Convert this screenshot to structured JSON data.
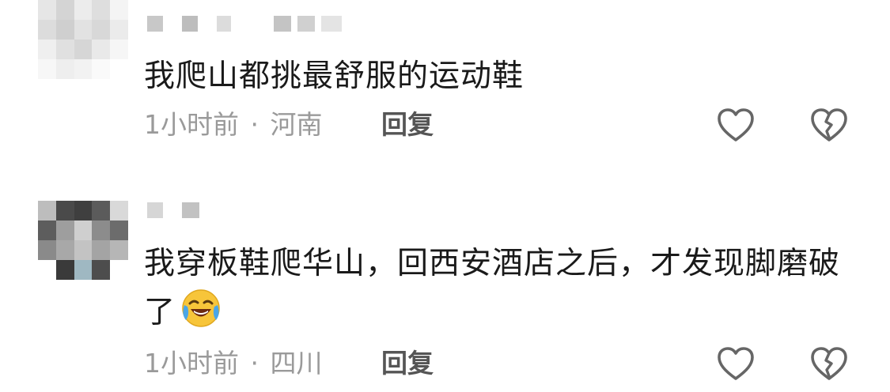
{
  "comments": [
    {
      "text": "我爬山都挑最舒服的运动鞋",
      "time": "1小时前",
      "separator": "·",
      "location": "河南",
      "reply_label": "回复"
    },
    {
      "text": "我穿板鞋爬华山，回西安酒店之后，才发现脚磨破了",
      "emoji": "face-with-tears-of-joy",
      "time": "1小时前",
      "separator": "·",
      "location": "四川",
      "reply_label": "回复"
    }
  ],
  "icons": {
    "like": "heart-icon",
    "dislike": "broken-heart-icon"
  },
  "colors": {
    "text": "#1a1a1a",
    "meta": "#9a9a9a",
    "reply": "#555555",
    "icon": "#666666"
  }
}
